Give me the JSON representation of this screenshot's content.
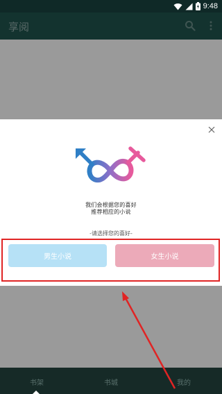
{
  "status_bar": {
    "time": "9:48"
  },
  "app_bar": {
    "title": "享阅"
  },
  "dialog": {
    "message_line1": "我们会根据您的喜好",
    "message_line2": "推荐相应的小说",
    "hint": "-请选择您的喜好-",
    "male_button_label": "男生小说",
    "female_button_label": "女生小说"
  },
  "bottom_nav": {
    "items": [
      {
        "label": "书架"
      },
      {
        "label": "书城"
      },
      {
        "label": "我的"
      }
    ]
  },
  "colors": {
    "app_bar": "#13332f",
    "male_button": "#b6e1f6",
    "female_button": "#ecaab9",
    "highlight": "#e02424"
  }
}
